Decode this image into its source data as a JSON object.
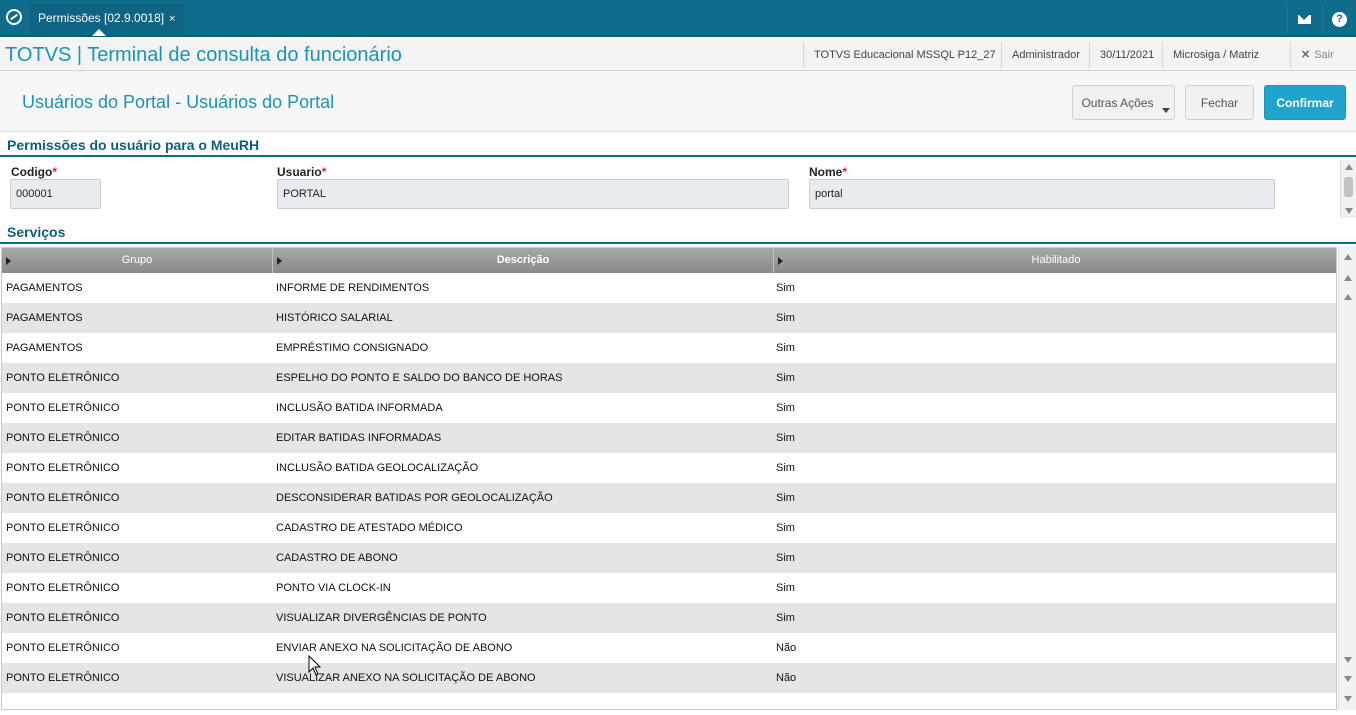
{
  "tab": {
    "label": "Permissões [02.9.0018]",
    "close": "×"
  },
  "app": {
    "title": "TOTVS | Terminal de consulta do funcionário",
    "environment": "TOTVS Educacional MSSQL P12_27",
    "user": "Administrador",
    "date": "30/11/2021",
    "company": "Microsiga / Matriz",
    "logout_label": "Sair",
    "logout_icon": "✕"
  },
  "page": {
    "title": "Usuários do Portal - Usuários do Portal",
    "actions": {
      "other": "Outras Ações",
      "close": "Fechar",
      "confirm": "Confirmar"
    }
  },
  "form": {
    "section_title": "Permissões do usuário para o MeuRH",
    "fields": [
      {
        "label": "Codigo",
        "required_mark": "*",
        "value": "000001"
      },
      {
        "label": "Usuario",
        "required_mark": "*",
        "value": "PORTAL"
      },
      {
        "label": "Nome",
        "required_mark": "*",
        "value": "portal"
      }
    ]
  },
  "services": {
    "section_title": "Serviços",
    "columns": [
      "Grupo",
      "Descrição",
      "Habilitado"
    ],
    "rows": [
      [
        "PAGAMENTOS",
        "INFORME DE RENDIMENTOS",
        "Sim"
      ],
      [
        "PAGAMENTOS",
        "HISTÓRICO SALARIAL",
        "Sim"
      ],
      [
        "PAGAMENTOS",
        "EMPRÉSTIMO CONSIGNADO",
        "Sim"
      ],
      [
        "PONTO ELETRÔNICO",
        "ESPELHO DO PONTO E SALDO DO BANCO DE HORAS",
        "Sim"
      ],
      [
        "PONTO ELETRÔNICO",
        "INCLUSÃO BATIDA INFORMADA",
        "Sim"
      ],
      [
        "PONTO ELETRÔNICO",
        "EDITAR BATIDAS INFORMADAS",
        "Sim"
      ],
      [
        "PONTO ELETRÔNICO",
        "INCLUSÃO BATIDA GEOLOCALIZAÇÃO",
        "Sim"
      ],
      [
        "PONTO ELETRÔNICO",
        "DESCONSIDERAR BATIDAS POR GEOLOCALIZAÇÃO",
        "Sim"
      ],
      [
        "PONTO ELETRÔNICO",
        "CADASTRO DE ATESTADO MÉDICO",
        "Sim"
      ],
      [
        "PONTO ELETRÔNICO",
        "CADASTRO DE ABONO",
        "Sim"
      ],
      [
        "PONTO ELETRÔNICO",
        "PONTO VIA CLOCK-IN",
        "Sim"
      ],
      [
        "PONTO ELETRÔNICO",
        "VISUALIZAR DIVERGÊNCIAS DE PONTO",
        "Sim"
      ],
      [
        "PONTO ELETRÔNICO",
        "ENVIAR ANEXO NA SOLICITAÇÃO DE ABONO",
        "Não"
      ],
      [
        "PONTO ELETRÔNICO",
        "VISUALIZAR ANEXO NA SOLICITAÇÃO DE ABONO",
        "Não"
      ]
    ]
  },
  "colors": {
    "topbar": "#0f6c8a",
    "accent": "#1b93b5",
    "primary_button": "#20a4cb"
  }
}
